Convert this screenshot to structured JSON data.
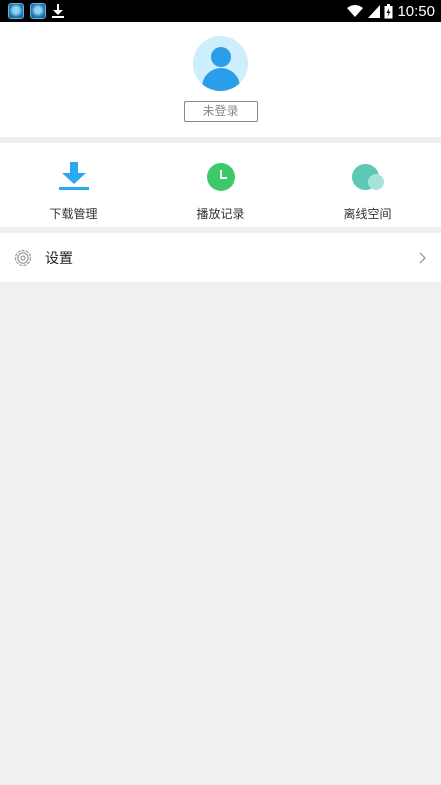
{
  "status_bar": {
    "time": "10:50",
    "icons": [
      "app-icon",
      "app-icon",
      "download-icon",
      "wifi-icon",
      "signal-icon",
      "battery-icon"
    ]
  },
  "profile": {
    "avatar": "user-avatar-icon",
    "login_label": "未登录"
  },
  "quick_actions": [
    {
      "label": "下载管理",
      "icon": "download-icon",
      "color": "#2aa8f2"
    },
    {
      "label": "播放记录",
      "icon": "clock-icon",
      "color": "#3dc96a"
    },
    {
      "label": "离线空间",
      "icon": "cloud-icon",
      "color": "#5cc8b5"
    }
  ],
  "settings": {
    "label": "设置",
    "icon": "gear-icon"
  },
  "colors": {
    "background": "#eff0f2",
    "surface": "#ffffff"
  }
}
